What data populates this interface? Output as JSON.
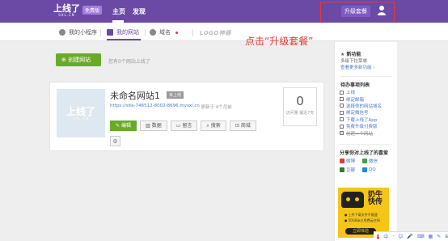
{
  "topbar": {
    "logo_main": "上线了",
    "logo_sub": "SXL.CN",
    "logo_badge": "免费版",
    "nav_home": "主页",
    "nav_discover": "发现",
    "upgrade_label": "升级套餐"
  },
  "tabs": [
    {
      "label": "我的小程序"
    },
    {
      "label": "我的网站"
    },
    {
      "label": "域名"
    },
    {
      "label": "LOGO神器"
    }
  ],
  "annotation": "点击“升级套餐”",
  "main": {
    "create_label": "创建网站",
    "create_hint": "您有0个网站上线了",
    "site": {
      "name": "未命名网站1",
      "badge": "未上线",
      "url": "https://site-746512-8002-8696.mysxl.cn",
      "updated": "· 更新于 4个月前",
      "visits": "0",
      "visits_label": "访问量 最近7天"
    },
    "actions": [
      "编辑",
      "数据",
      "留言",
      "搜索",
      "商城"
    ]
  },
  "sidebar": {
    "new_title": "新功能",
    "new_text": "多级下拉菜单",
    "new_link": "查看更多新功能 ›",
    "todo_title": "待办事项列表",
    "todos": [
      "上线",
      "绑定邮箱",
      "选择你的网站域名",
      "绑定微信号",
      "下载上线了App",
      "免费升级付费版",
      "创建一个网站"
    ],
    "share_title": "分享你对上线了的喜爱",
    "shares": [
      {
        "label": "微博",
        "color": "#e53935"
      },
      {
        "label": "微信",
        "color": "#43a047"
      },
      {
        "label": "豆瓣",
        "color": "#2e7d32"
      },
      {
        "label": "QQ",
        "color": "#1e88e5"
      }
    ]
  },
  "ad": {
    "title": "奶牛快传",
    "line1": "● 上传下载文件不限速",
    "line2": "● 50GB永久免费云空间",
    "button": "立即体验"
  },
  "tray": {
    "ime": "中",
    "icons": [
      "·",
      "☺",
      "🎤",
      "⌨",
      "▦",
      "✎",
      "⊞"
    ]
  },
  "colors": {
    "brand": "#6b4aa6",
    "primary_green": "#6aaa2a",
    "annotation_red": "#e53935"
  }
}
